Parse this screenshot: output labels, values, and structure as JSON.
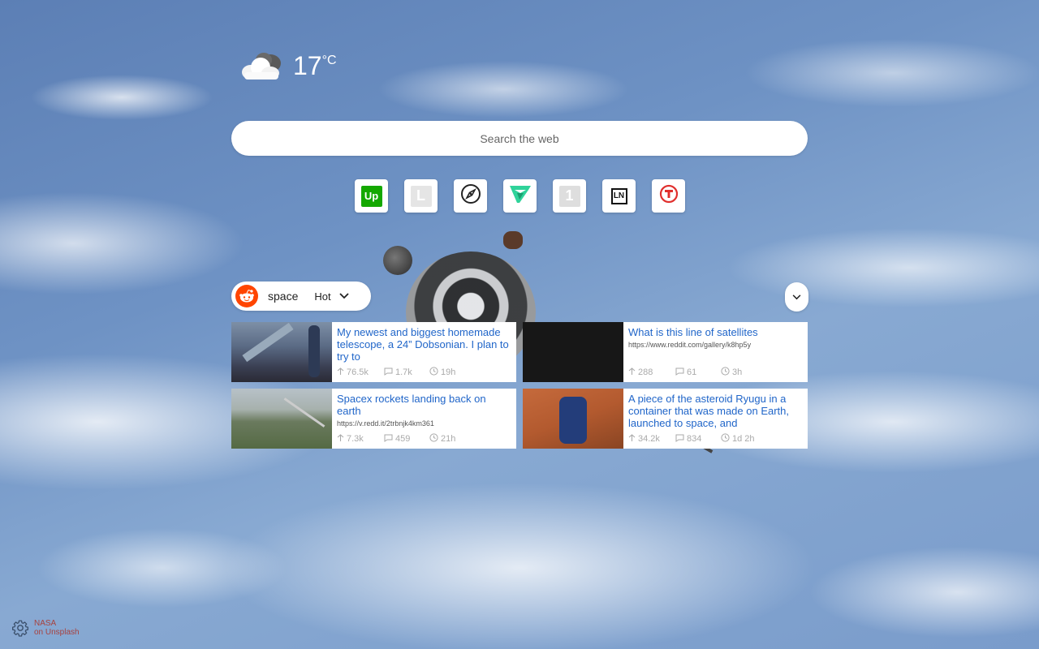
{
  "weather": {
    "icon": "cloudy-icon",
    "temperature": "17",
    "unit": "°C"
  },
  "search": {
    "placeholder": "Search the web"
  },
  "shortcuts": [
    {
      "name": "upwork",
      "icon": "upwork-icon",
      "glyph": "Up",
      "color": "#14a800"
    },
    {
      "name": "l-site",
      "icon": "letter-l-icon",
      "glyph": "L",
      "color": "#e5e5e5"
    },
    {
      "name": "safari-compass",
      "icon": "compass-icon"
    },
    {
      "name": "vue-checkmark",
      "icon": "v-check-icon",
      "color": "#2fd39a"
    },
    {
      "name": "one-site",
      "icon": "number-one-icon",
      "glyph": "1",
      "color": "#dedede"
    },
    {
      "name": "ln-site",
      "icon": "ln-icon",
      "glyph": "LN"
    },
    {
      "name": "t-site",
      "icon": "t-circle-icon",
      "color": "#e0302e"
    }
  ],
  "reddit": {
    "subreddit": "space",
    "sort": "Hot",
    "accent": "#ff4500",
    "posts": [
      {
        "title": "My newest and biggest homemade telescope, a 24” Dobsonian. I plan to try to",
        "url": "",
        "upvotes": "76.5k",
        "comments": "1.7k",
        "age": "19h"
      },
      {
        "title": "What is this line of satellites",
        "url": "https://www.reddit.com/gallery/k8hp5y",
        "upvotes": "288",
        "comments": "61",
        "age": "3h"
      },
      {
        "title": "Spacex rockets landing back on earth",
        "url": "https://v.redd.it/2trbnjk4km361",
        "upvotes": "7.3k",
        "comments": "459",
        "age": "21h"
      },
      {
        "title": "A piece of the asteroid Ryugu in a container that was made on Earth, launched to space, and",
        "url": "",
        "upvotes": "34.2k",
        "comments": "834",
        "age": "1d 2h"
      }
    ]
  },
  "footer": {
    "credit_line1": "NASA",
    "credit_line2": "on Unsplash",
    "credit_color": "#a7423f"
  },
  "colors": {
    "link": "#2166c9",
    "meta": "#aaaaaa"
  }
}
